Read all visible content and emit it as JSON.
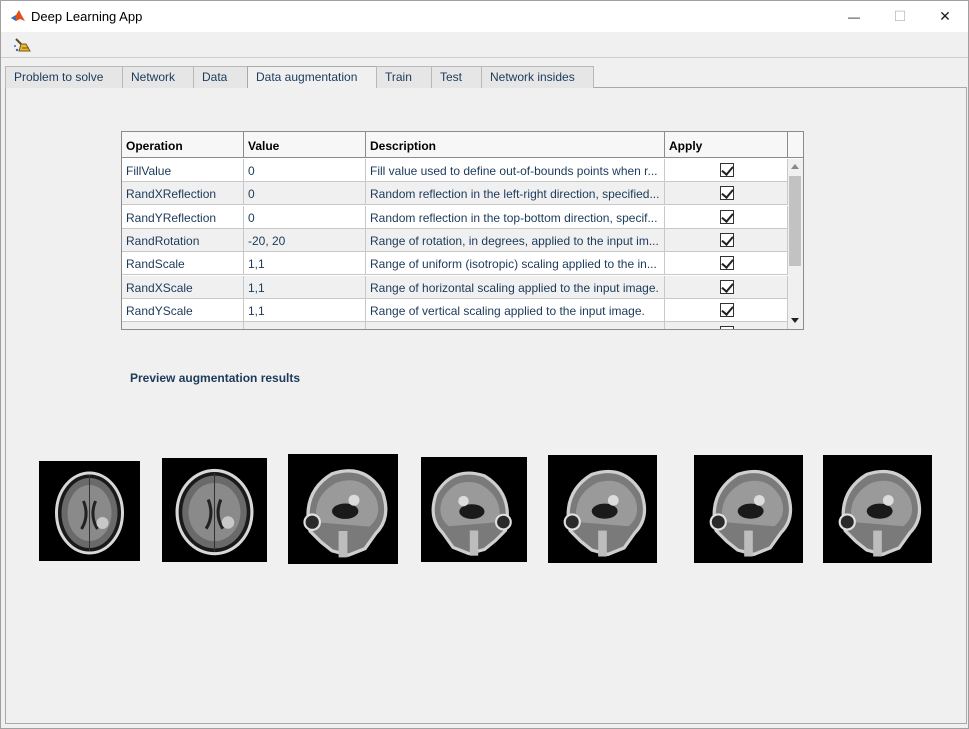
{
  "window": {
    "title": "Deep Learning App",
    "minimize_glyph": "—",
    "maximize_glyph": "☐",
    "close_glyph": "✕"
  },
  "toolbar": {
    "tool_icon": "brush-icon"
  },
  "tabs": [
    {
      "label": "Problem to solve",
      "active": false
    },
    {
      "label": "Network",
      "active": false
    },
    {
      "label": "Data",
      "active": false
    },
    {
      "label": "Data augmentation",
      "active": true
    },
    {
      "label": "Train",
      "active": false
    },
    {
      "label": "Test",
      "active": false
    },
    {
      "label": "Network insides",
      "active": false
    }
  ],
  "table": {
    "headers": [
      "Operation",
      "Value",
      "Description",
      "Apply"
    ],
    "rows": [
      {
        "operation": "FillValue",
        "value": "0",
        "description": "Fill value used to define out-of-bounds points when r...",
        "apply": true
      },
      {
        "operation": "RandXReflection",
        "value": "0",
        "description": "Random reflection in the left-right direction, specified...",
        "apply": true
      },
      {
        "operation": "RandYReflection",
        "value": "0",
        "description": "Random reflection in the top-bottom direction, specif...",
        "apply": true
      },
      {
        "operation": "RandRotation",
        "value": "-20, 20",
        "description": "Range of rotation, in degrees, applied to the input im...",
        "apply": true
      },
      {
        "operation": "RandScale",
        "value": "1,1",
        "description": "Range of uniform (isotropic) scaling applied to the in...",
        "apply": true
      },
      {
        "operation": "RandXScale",
        "value": "1,1",
        "description": "Range of horizontal scaling applied to the input image.",
        "apply": true
      },
      {
        "operation": "RandYScale",
        "value": "1,1",
        "description": "Range of vertical scaling applied to the input image.",
        "apply": true
      },
      {
        "operation": "",
        "value": "",
        "description": "",
        "apply": true
      }
    ]
  },
  "preview": {
    "label": "Preview augmentation results",
    "images": [
      "axial-scan",
      "axial-scan",
      "sagittal-scan",
      "sagittal-scan",
      "sagittal-scan",
      "sagittal-scan",
      "sagittal-scan"
    ]
  }
}
